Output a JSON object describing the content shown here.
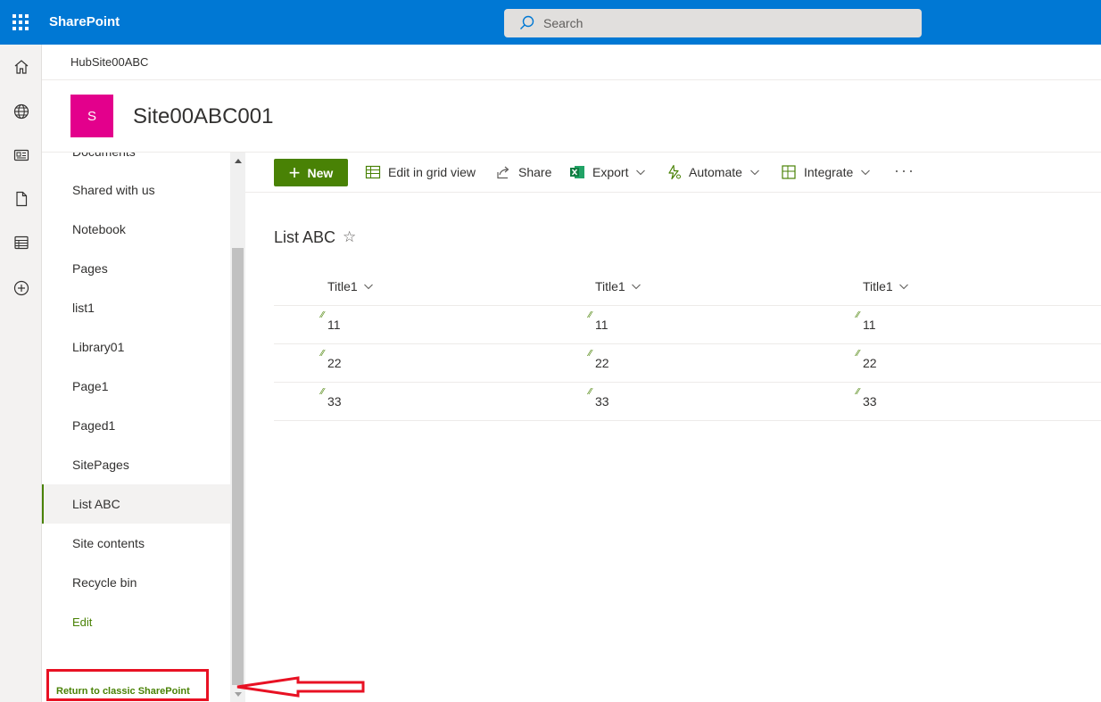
{
  "app": {
    "brand": "SharePoint",
    "search_placeholder": "Search"
  },
  "rail": {
    "items": [
      "home-icon",
      "globe-icon",
      "news-icon",
      "file-icon",
      "lists-icon",
      "create-icon"
    ]
  },
  "site": {
    "breadcrumb": "HubSite00ABC",
    "logo_letter": "S",
    "title": "Site00ABC001"
  },
  "leftnav": {
    "partial_top": "Documents",
    "items": [
      "Shared with us",
      "Notebook",
      "Pages",
      "list1",
      "Library01",
      "Page1",
      "Paged1",
      "SitePages",
      "List ABC",
      "Site contents",
      "Recycle bin"
    ],
    "selected": "List ABC",
    "edit_label": "Edit",
    "classic_link": "Return to classic SharePoint"
  },
  "commandbar": {
    "new_label": "New",
    "grid_label": "Edit in grid view",
    "share_label": "Share",
    "export_label": "Export",
    "automate_label": "Automate",
    "integrate_label": "Integrate",
    "more_label": "···"
  },
  "list": {
    "title": "List ABC",
    "columns": [
      "Title1",
      "Title1",
      "Title1"
    ],
    "rows": [
      [
        "11",
        "11",
        "11"
      ],
      [
        "22",
        "22",
        "22"
      ],
      [
        "33",
        "33",
        "33"
      ]
    ]
  },
  "colors": {
    "suite_bar": "#0078d4",
    "accent_green": "#498205",
    "site_logo": "#e3008c",
    "annotation_red": "#e81123"
  }
}
